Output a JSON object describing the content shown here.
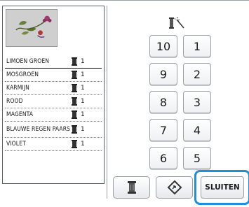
{
  "preview": {
    "icon": "embroidery-flower-preview"
  },
  "colors": [
    {
      "name": "LIMOEN GROEN",
      "count": "1",
      "selected": true
    },
    {
      "name": "MOSGROEN",
      "count": "1"
    },
    {
      "name": "KARMIJN",
      "count": "1"
    },
    {
      "name": "ROOD",
      "count": "1"
    },
    {
      "name": "MAGENTA",
      "count": "1"
    },
    {
      "name": "BLAUWE REGEN PAARS",
      "count": "1"
    },
    {
      "name": "VIOLET",
      "count": "1"
    }
  ],
  "needle_buttons": [
    "10",
    "1",
    "9",
    "2",
    "8",
    "3",
    "7",
    "4",
    "6",
    "5"
  ],
  "toolbar": {
    "spool_button_icon": "thread-spool-icon",
    "diamond_button_icon": "diamond-arrow-icon",
    "close_label": "SLUITEN"
  },
  "accent_color": "#1e8fd8"
}
